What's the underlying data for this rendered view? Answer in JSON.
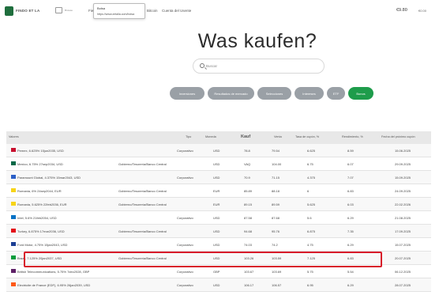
{
  "topbar": {
    "logo_text": "FINDO ET LA",
    "nav_small": "Browse",
    "nav_letter": "Fie",
    "tooltip_title": "Bolsa",
    "tooltip_url": "https://www.zetalia.com/bolsa",
    "bitcoin": "Bitcoin",
    "ledger": "Cuenta del Usente",
    "price": "€9.80",
    "price_sub": "€0.00"
  },
  "hero": {
    "title": "Was kaufen?",
    "search_placeholder": "Buscar"
  },
  "chips": [
    {
      "label": "Inversiones",
      "active": false
    },
    {
      "label": "Resultados de mercado",
      "active": false
    },
    {
      "label": "Selecciones",
      "active": false
    },
    {
      "label": "Intereses",
      "active": false
    },
    {
      "label": "ETF",
      "active": false
    },
    {
      "label": "Bonos",
      "active": true
    }
  ],
  "table": {
    "headers": {
      "name": "Valores",
      "type": "Tipo",
      "currency": "Moneda",
      "buy": "Kauf",
      "sell": "Venta",
      "coupon": "Tasa de cupón, %",
      "yield": "Rendimiento, %",
      "next_coupon": "Fecha del próximo cupón"
    },
    "rows": [
      {
        "flag": "#c8102e",
        "name": "Pemex, 6.625% 15jun2035, USD",
        "issuer": "",
        "type": "Corporativo",
        "currency": "USD",
        "buy": "78.8",
        "sell": "79.54",
        "coupon": "6.625",
        "yield": "8.59",
        "next": "15.06.2025"
      },
      {
        "flag": "#006847",
        "name": "Mexico, 6.75% 27sep2034, USD",
        "issuer": "Gobierno/Tesorería/Banco Central",
        "type": "",
        "currency": "USD",
        "buy": "VAQ",
        "sell": "104.00",
        "coupon": "6.75",
        "yield": "6.07",
        "next": "29.09.2025"
      },
      {
        "flag": "#2b5fc7",
        "name": "Paramount Global, 4.375% 15mar2043, USD",
        "issuer": "",
        "type": "Corporativo",
        "currency": "USD",
        "buy": "70.9",
        "sell": "71.15",
        "coupon": "4.375",
        "yield": "7.07",
        "next": "15.09.2025"
      },
      {
        "flag": "#f7d417",
        "name": "Romania, 6% 24sep2044, EUR",
        "issuer": "Gobierno/Tesorería/Banco Central",
        "type": "",
        "currency": "EUR",
        "buy": "85.89",
        "sell": "88.18",
        "coupon": "6",
        "yield": "6.83",
        "next": "24.09.2025"
      },
      {
        "flag": "#f7d417",
        "name": "Romania, 5.625% 22feb2036, EUR",
        "issuer": "Gobierno/Tesorería/Banco Central",
        "type": "",
        "currency": "EUR",
        "buy": "89.15",
        "sell": "89.59",
        "coupon": "5.625",
        "yield": "6.03",
        "next": "22.02.2026"
      },
      {
        "flag": "#0071c5",
        "name": "Intel, 5.6% 21feb2054, USD",
        "issuer": "",
        "type": "Corporativo",
        "currency": "USD",
        "buy": "87.58",
        "sell": "87.68",
        "coupon": "5.6",
        "yield": "6.29",
        "next": "21.08.2025"
      },
      {
        "flag": "#e30a17",
        "name": "Turkey, 6.875% 17mar2036, USD",
        "issuer": "Gobierno/Tesorería/Banco Central",
        "type": "",
        "currency": "USD",
        "buy": "94.68",
        "sell": "95.76",
        "coupon": "6.875",
        "yield": "7.35",
        "next": "17.09.2025"
      },
      {
        "flag": "#1c3f94",
        "name": "Ford Motor, 4.75% 15jan2043, USD",
        "issuer": "",
        "type": "Corporativo",
        "currency": "USD",
        "buy": "74.03",
        "sell": "74.2",
        "coupon": "4.75",
        "yield": "6.29",
        "next": "15.07.2025"
      },
      {
        "flag": "#009c3b",
        "name": "Brazil, 7.125% 20jan2037, USD",
        "issuer": "Gobierno/Tesorería/Banco Central",
        "type": "",
        "currency": "USD",
        "buy": "103.26",
        "sell": "103.59",
        "coupon": "7.125",
        "yield": "6.83",
        "next": "20.07.2025"
      },
      {
        "flag": "#5f2167",
        "name": "British Telecommunications, 5.75% 7dec2028, GBP",
        "issuer": "",
        "type": "Corporativo",
        "currency": "GBP",
        "buy": "103.67",
        "sell": "103.69",
        "coupon": "5.75",
        "yield": "5.54",
        "next": "06.12.2025"
      },
      {
        "flag": "#fe5815",
        "name": "Electricite de France (EDF), 6.95% 26jan2039, USD",
        "issuer": "",
        "type": "Corporativo",
        "currency": "USD",
        "buy": "106.17",
        "sell": "106.57",
        "coupon": "6.95",
        "yield": "6.29",
        "next": "28.07.2025"
      }
    ]
  }
}
